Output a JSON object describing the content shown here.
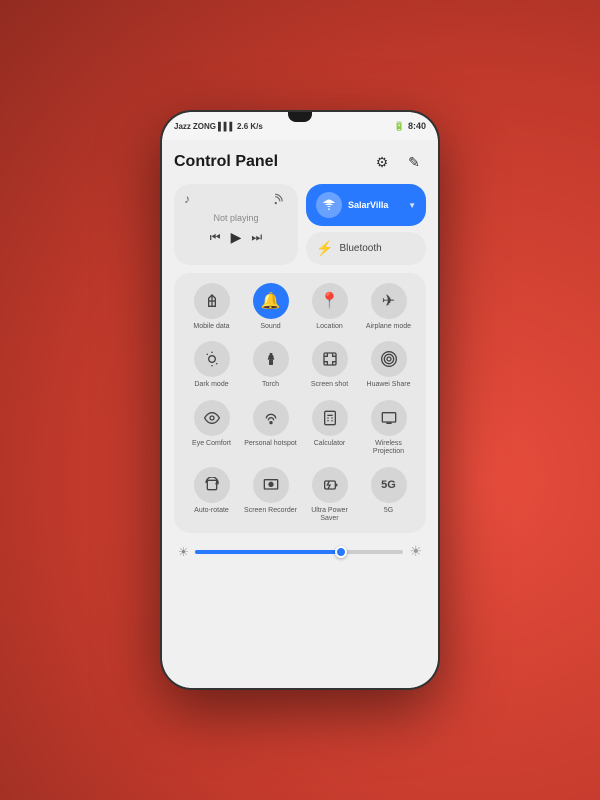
{
  "statusBar": {
    "carrier1": "Jazz",
    "carrier2": "ZONG",
    "time": "8:40",
    "network_speed": "2.6 K/s",
    "battery_icon": "🔋"
  },
  "header": {
    "title": "Control Panel",
    "settings_icon": "⚙",
    "edit_icon": "✎"
  },
  "mediaCard": {
    "not_playing": "Not playing"
  },
  "wifiCard": {
    "name": "SalarVilla",
    "arrow": "▼"
  },
  "bluetoothCard": {
    "label": "Bluetooth"
  },
  "gridItems": {
    "row1": [
      {
        "label": "Mobile data",
        "icon": "↕",
        "active": false
      },
      {
        "label": "Sound",
        "icon": "🔔",
        "active": true
      },
      {
        "label": "Location",
        "icon": "📍",
        "active": false
      },
      {
        "label": "Airplane mode",
        "icon": "✈",
        "active": false
      }
    ],
    "row2": [
      {
        "label": "Dark mode",
        "icon": "👁",
        "active": false
      },
      {
        "label": "Torch",
        "icon": "🔦",
        "active": false
      },
      {
        "label": "Screen shot",
        "icon": "📱",
        "active": false
      },
      {
        "label": "Huawei Share",
        "icon": "((·))",
        "active": false
      }
    ],
    "row3": [
      {
        "label": "Eye Comfort",
        "icon": "👁",
        "active": false
      },
      {
        "label": "Personal hotspot",
        "icon": "((·))",
        "active": false
      },
      {
        "label": "Calculator",
        "icon": "⊞",
        "active": false
      },
      {
        "label": "Wireless Projection",
        "icon": "▣",
        "active": false
      }
    ],
    "row4": [
      {
        "label": "Auto-rotate",
        "icon": "⟳",
        "active": false
      },
      {
        "label": "Screen Recorder",
        "icon": "⬤",
        "active": false
      },
      {
        "label": "Ultra Power Saver",
        "icon": "⊕",
        "active": false
      },
      {
        "label": "5G",
        "icon": "5G",
        "active": false
      }
    ]
  },
  "brightness": {
    "min_icon": "☀",
    "max_icon": "☀",
    "fill_percent": 70
  }
}
